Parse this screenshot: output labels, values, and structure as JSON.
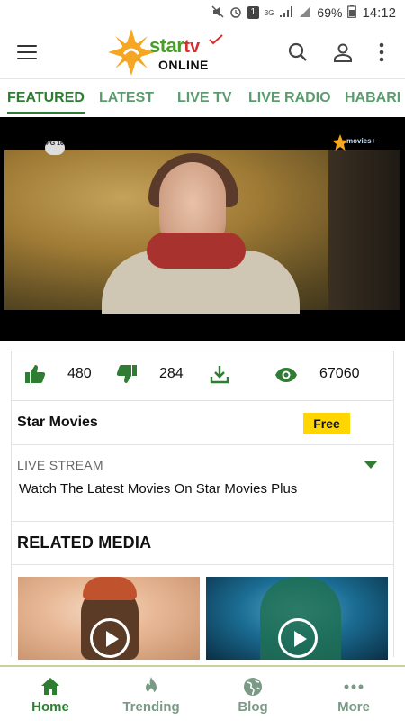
{
  "status_bar": {
    "battery": "69%",
    "time": "14:12",
    "network": "3G",
    "sim": "1"
  },
  "app": {
    "logo": {
      "word": "star",
      "suffix": "tv",
      "subtitle": "ONLINE"
    }
  },
  "tabs": [
    {
      "label": "FEATURED",
      "active": true
    },
    {
      "label": "LATEST",
      "active": false
    },
    {
      "label": "LIVE TV",
      "active": false
    },
    {
      "label": "LIVE RADIO",
      "active": false
    },
    {
      "label": "HABARI",
      "active": false
    }
  ],
  "player": {
    "rating_badge": "PG 16",
    "channel_watermark": "movies+"
  },
  "stats": {
    "likes": "480",
    "dislikes": "284",
    "views": "67060"
  },
  "channel": {
    "name": "Star Movies",
    "price_badge": "Free"
  },
  "live": {
    "label": "LIVE STREAM",
    "description": "Watch The Latest Movies On Star Movies Plus"
  },
  "related": {
    "title": "RELATED MEDIA"
  },
  "bottom_nav": [
    {
      "label": "Home",
      "icon": "home-icon",
      "active": true
    },
    {
      "label": "Trending",
      "icon": "flame-icon",
      "active": false
    },
    {
      "label": "Blog",
      "icon": "globe-icon",
      "active": false
    },
    {
      "label": "More",
      "icon": "more-dots-icon",
      "active": false
    }
  ],
  "colors": {
    "brand_green": "#2e7d32",
    "tab_inactive": "#5a9c6e",
    "free_badge": "#ffd600",
    "logo_red": "#d32f2f"
  }
}
